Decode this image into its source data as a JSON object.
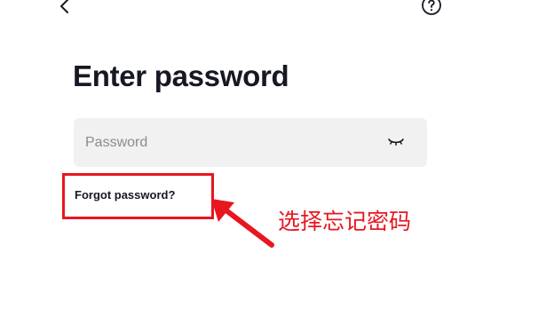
{
  "header": {
    "back_icon": "chevron-left-icon",
    "help_icon": "question-circle-icon"
  },
  "main": {
    "title": "Enter password",
    "password_field": {
      "placeholder": "Password",
      "value": "",
      "toggle_icon": "eye-closed-icon"
    },
    "forgot_password_label": "Forgot password?"
  },
  "annotation": {
    "text": "选择忘记密码",
    "color": "#e8161f"
  },
  "colors": {
    "text_primary": "#161823",
    "input_bg": "#f1f1f2",
    "placeholder": "#8a8b91",
    "annotation_red": "#e8161f"
  }
}
